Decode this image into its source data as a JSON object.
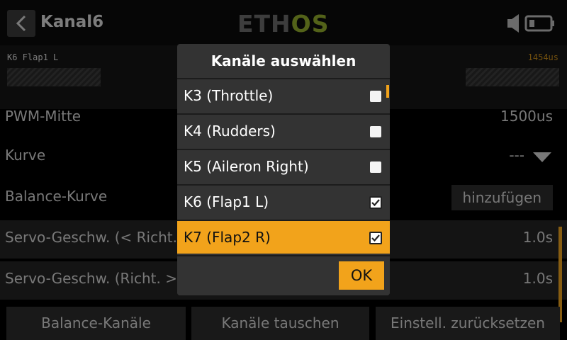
{
  "header": {
    "title": "Kanal6",
    "logo_left": "ETH",
    "logo_right": "OS",
    "icons": [
      "back-arrow-icon",
      "speaker-icon",
      "battery-icon"
    ]
  },
  "strip": {
    "label": "K6  Flap1 L",
    "value": "1454us"
  },
  "rows": {
    "pwm_label": "PWM-Mitte",
    "pwm_value": "1500us",
    "curve_label": "Kurve",
    "curve_value": "---",
    "balance_curve_label": "Balance-Kurve",
    "balance_curve_button": "hinzufügen",
    "servo1_label": "Servo-Geschw. (< Richt.",
    "servo1_value": "1.0s",
    "servo2_label": "Servo-Geschw. (Richt. >",
    "servo2_value": "1.0s"
  },
  "bottom_buttons": {
    "balance": "Balance-Kanäle",
    "swap": "Kanäle tauschen",
    "reset": "Einstell. zurücksetzen"
  },
  "modal": {
    "title": "Kanäle auswählen",
    "options": [
      {
        "label": "K3 (Throttle)",
        "checked": false,
        "selected": false
      },
      {
        "label": "K4 (Rudders)",
        "checked": false,
        "selected": false
      },
      {
        "label": "K5 (Aileron Right)",
        "checked": false,
        "selected": false
      },
      {
        "label": "K6 (Flap1 L)",
        "checked": true,
        "selected": false
      },
      {
        "label": "K7 (Flap2 R)",
        "checked": true,
        "selected": true
      }
    ],
    "ok_label": "OK"
  },
  "colors": {
    "accent": "#f2a31b",
    "logo_green": "#8faa2c"
  }
}
